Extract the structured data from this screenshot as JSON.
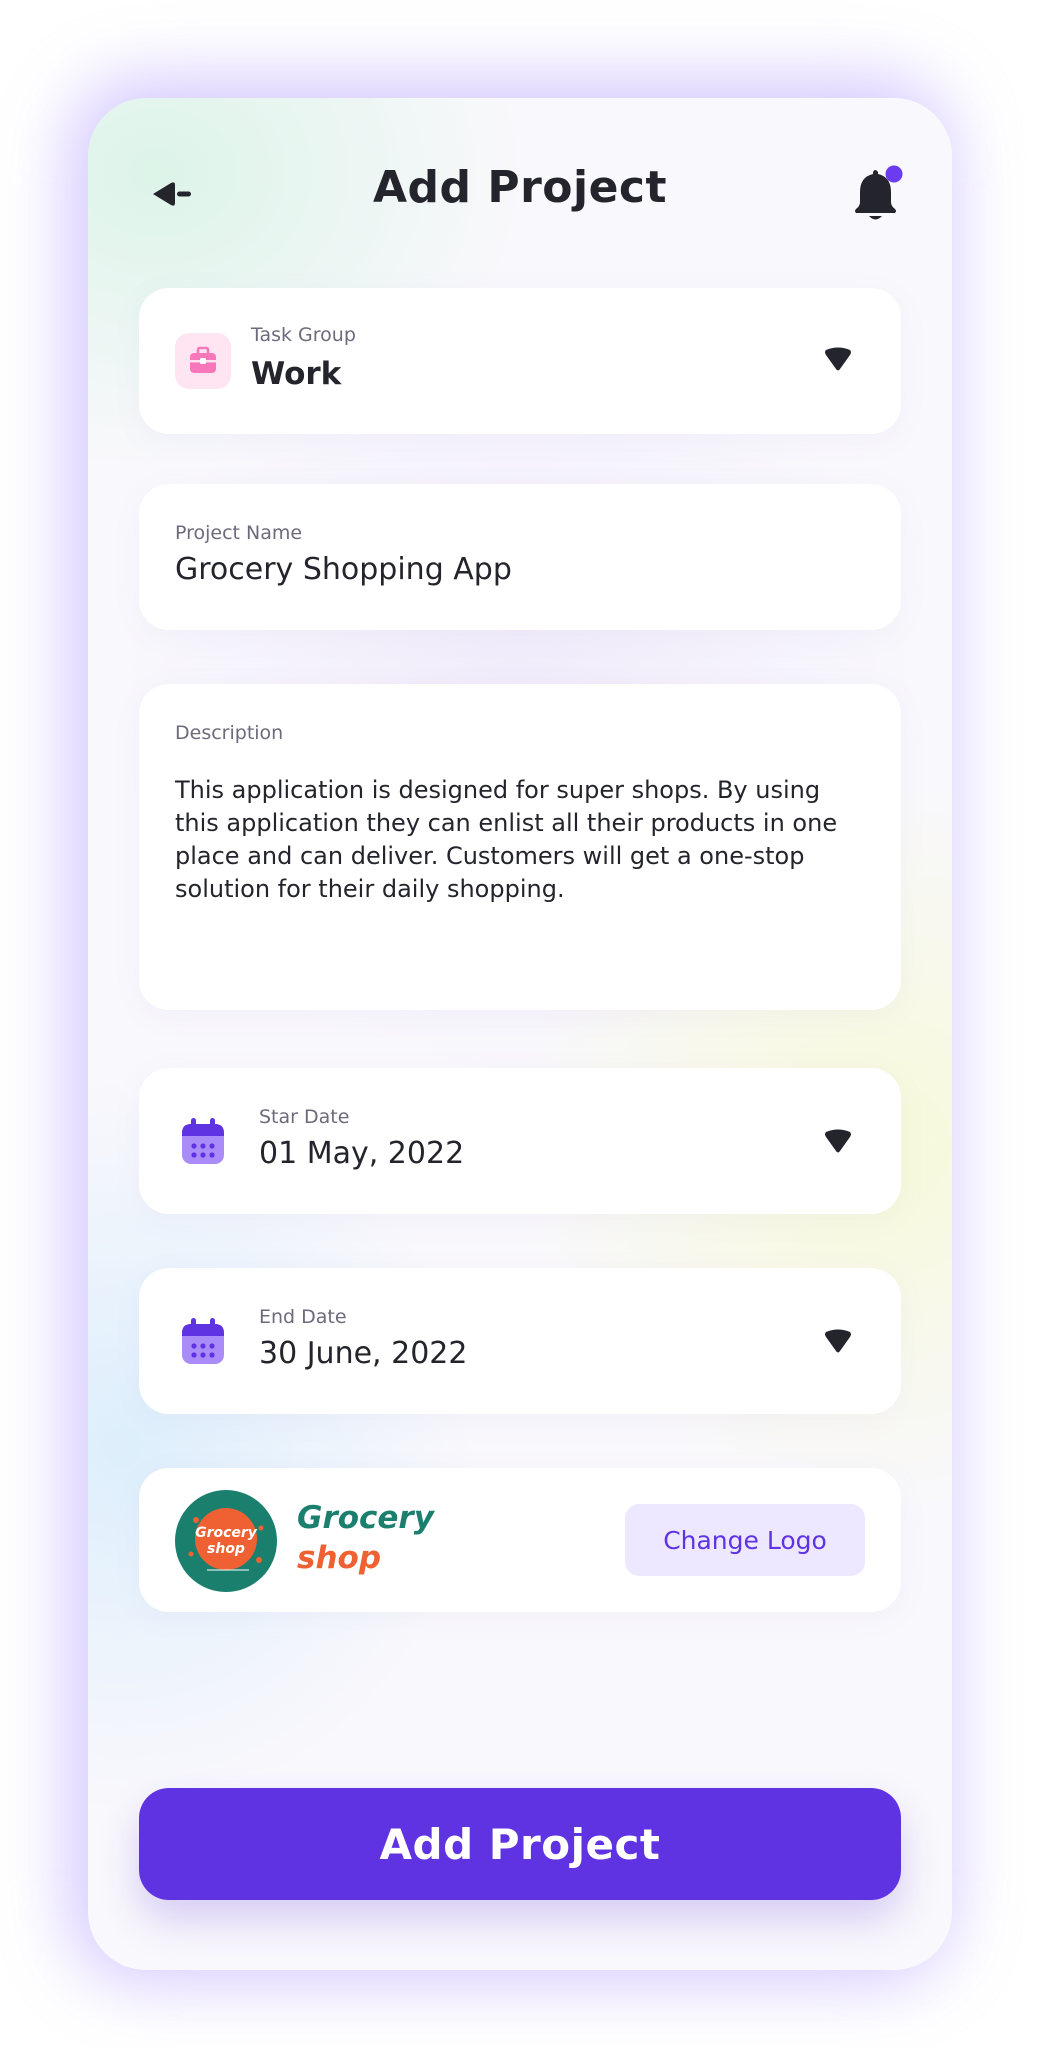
{
  "header": {
    "title": "Add Project",
    "back_icon": "back-arrow-icon",
    "notification_icon": "bell-icon",
    "notification_badge_color": "#6b3bf0"
  },
  "task_group": {
    "label": "Task Group",
    "value": "Work",
    "icon": "briefcase-icon",
    "icon_color": "#f778ba",
    "icon_bg": "#ffe4f2"
  },
  "project_name": {
    "label": "Project Name",
    "value": "Grocery Shopping App"
  },
  "description": {
    "label": "Description",
    "value": "This application is designed for super shops. By using this application they can enlist all their products in one place and can deliver. Customers will get a one-stop solution for their daily shopping."
  },
  "start_date": {
    "label": "Star Date",
    "value": "01 May, 2022",
    "icon": "calendar-icon"
  },
  "end_date": {
    "label": "End Date",
    "value": "30 June, 2022",
    "icon": "calendar-icon"
  },
  "logo": {
    "brand_line1": "Grocery",
    "brand_line2": "shop",
    "badge_line1": "Grocery",
    "badge_line2": "shop",
    "brand_color_1": "#1b7f6e",
    "brand_color_2": "#ef6132",
    "change_label": "Change Logo"
  },
  "actions": {
    "add_project_label": "Add Project"
  },
  "colors": {
    "accent": "#5f33e1",
    "text_dark": "#24252c",
    "text_muted": "#6e6a7c"
  }
}
